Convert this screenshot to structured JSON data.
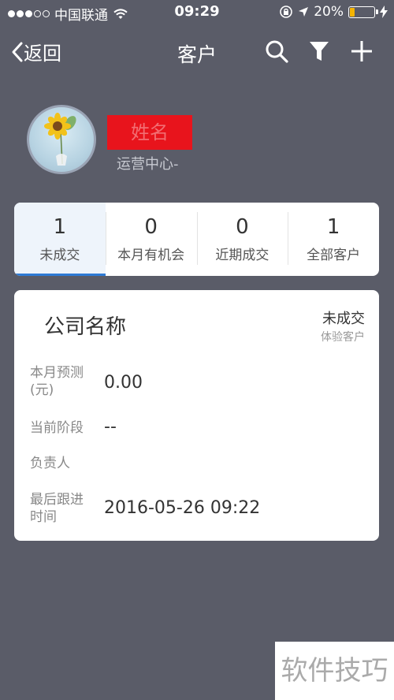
{
  "status_bar": {
    "carrier": "中国联通",
    "time": "09:29",
    "battery": "20%",
    "battery_level": 0.2
  },
  "nav": {
    "back_label": "返回",
    "title": "客户"
  },
  "profile": {
    "name": "姓名",
    "department": "运营中心-"
  },
  "tabs": [
    {
      "count": "1",
      "label": "未成交"
    },
    {
      "count": "0",
      "label": "本月有机会"
    },
    {
      "count": "0",
      "label": "近期成交"
    },
    {
      "count": "1",
      "label": "全部客户"
    }
  ],
  "customer": {
    "company": "公司名称",
    "status": "未成交",
    "type": "体验客户",
    "fields": [
      {
        "label": "本月预测(元)",
        "value": "0.00"
      },
      {
        "label": "当前阶段",
        "value": "--"
      },
      {
        "label": "负责人",
        "value": ""
      },
      {
        "label": "最后跟进时间",
        "value": "2016-05-26 09:22"
      }
    ]
  },
  "watermark": "软件技巧",
  "colors": {
    "background": "#5a5c68",
    "accent": "#2e7bd6",
    "name_redaction": "#e8141c",
    "battery": "#f5b400"
  }
}
